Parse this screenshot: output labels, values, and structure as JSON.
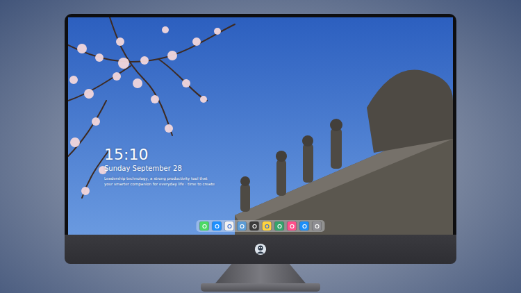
{
  "lock_screen": {
    "time": "15:10",
    "date": "Sunday September 28",
    "caption": [
      "Leadership technology, a strong productivity tool that",
      "your smarter companion for everyday life · time to create"
    ]
  },
  "dock": {
    "apps": [
      {
        "color": "#4cd964"
      },
      {
        "color": "#1e90ff"
      },
      {
        "color": "#f2f2f2"
      },
      {
        "color": "#5b9bd5"
      },
      {
        "color": "#3a3a3a"
      },
      {
        "color": "#ffd23f"
      },
      {
        "color": "#34a36b"
      },
      {
        "color": "#ff4f8b"
      },
      {
        "color": "#1c8ef9"
      },
      {
        "color": "#8e8e93"
      }
    ]
  }
}
